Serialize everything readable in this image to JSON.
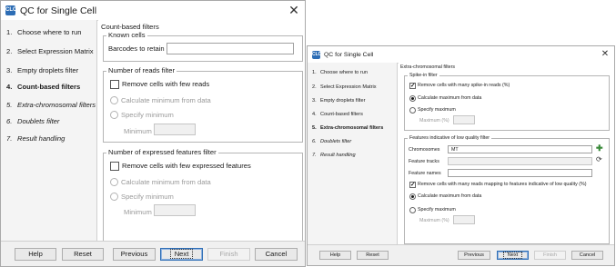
{
  "dialog1": {
    "title": "QC for Single Cell",
    "icon": "clc-app-icon",
    "close_label": "✕",
    "steps": [
      {
        "num": "1.",
        "label": "Choose where to run"
      },
      {
        "num": "2.",
        "label": "Select Expression Matrix"
      },
      {
        "num": "3.",
        "label": "Empty droplets filter"
      },
      {
        "num": "4.",
        "label": "Count-based filters"
      },
      {
        "num": "5.",
        "label": "Extra-chromosomal filters"
      },
      {
        "num": "6.",
        "label": "Doublets filter"
      },
      {
        "num": "7.",
        "label": "Result handling"
      }
    ],
    "section_title": "Count-based filters",
    "known_cells": {
      "title": "Known cells",
      "barcodes_label": "Barcodes to retain",
      "barcodes_value": ""
    },
    "reads_filter": {
      "title": "Number of reads filter",
      "remove_label": "Remove cells with few reads",
      "calc_label": "Calculate minimum from data",
      "specify_label": "Specify minimum",
      "minimum_label": "Minimum",
      "minimum_value": ""
    },
    "features_filter": {
      "title": "Number of expressed features filter",
      "remove_label": "Remove cells with few expressed features",
      "calc_label": "Calculate minimum from data",
      "specify_label": "Specify minimum",
      "minimum_label": "Minimum",
      "minimum_value": ""
    },
    "buttons": {
      "help": "Help",
      "reset": "Reset",
      "previous": "Previous",
      "next": "Next",
      "finish": "Finish",
      "cancel": "Cancel"
    }
  },
  "dialog2": {
    "title": "QC for Single Cell",
    "icon": "clc-app-icon",
    "close_label": "✕",
    "steps": [
      {
        "num": "1.",
        "label": "Choose where to run"
      },
      {
        "num": "2.",
        "label": "Select Expression Matrix"
      },
      {
        "num": "3.",
        "label": "Empty droplets filter"
      },
      {
        "num": "4.",
        "label": "Count-based filters"
      },
      {
        "num": "5.",
        "label": "Extra-chromosomal filters"
      },
      {
        "num": "6.",
        "label": "Doublets filter"
      },
      {
        "num": "7.",
        "label": "Result handling"
      }
    ],
    "section_title": "Extra-chromosomal filters",
    "spike_in": {
      "title": "Spike-in filter",
      "remove_label": "Remove cells with many spike-in reads (%)",
      "calc_label": "Calculate maximum from data",
      "specify_label": "Specify maximum",
      "maximum_label": "Maximum (%)",
      "maximum_value": ""
    },
    "low_quality": {
      "title": "Features indicative of low quality filter",
      "chromosomes_label": "Chromosomes",
      "chromosomes_value": "MT",
      "feature_tracks_label": "Feature tracks",
      "feature_tracks_value": "",
      "feature_names_label": "Feature names",
      "feature_names_value": "",
      "remove_label": "Remove cells with many reads mapping to features indicative of low quality (%)",
      "calc_label": "Calculate maximum from data",
      "specify_label": "Specify maximum",
      "maximum_label": "Maximum (%)",
      "maximum_value": ""
    },
    "buttons": {
      "help": "Help",
      "reset": "Reset",
      "previous": "Previous",
      "next": "Next",
      "finish": "Finish",
      "cancel": "Cancel"
    }
  },
  "colors": {
    "accent": "#2d6db5",
    "sidebar": "#f4f4f4",
    "footer": "#f0f0f0",
    "disabled_text": "#9a9a9a"
  }
}
